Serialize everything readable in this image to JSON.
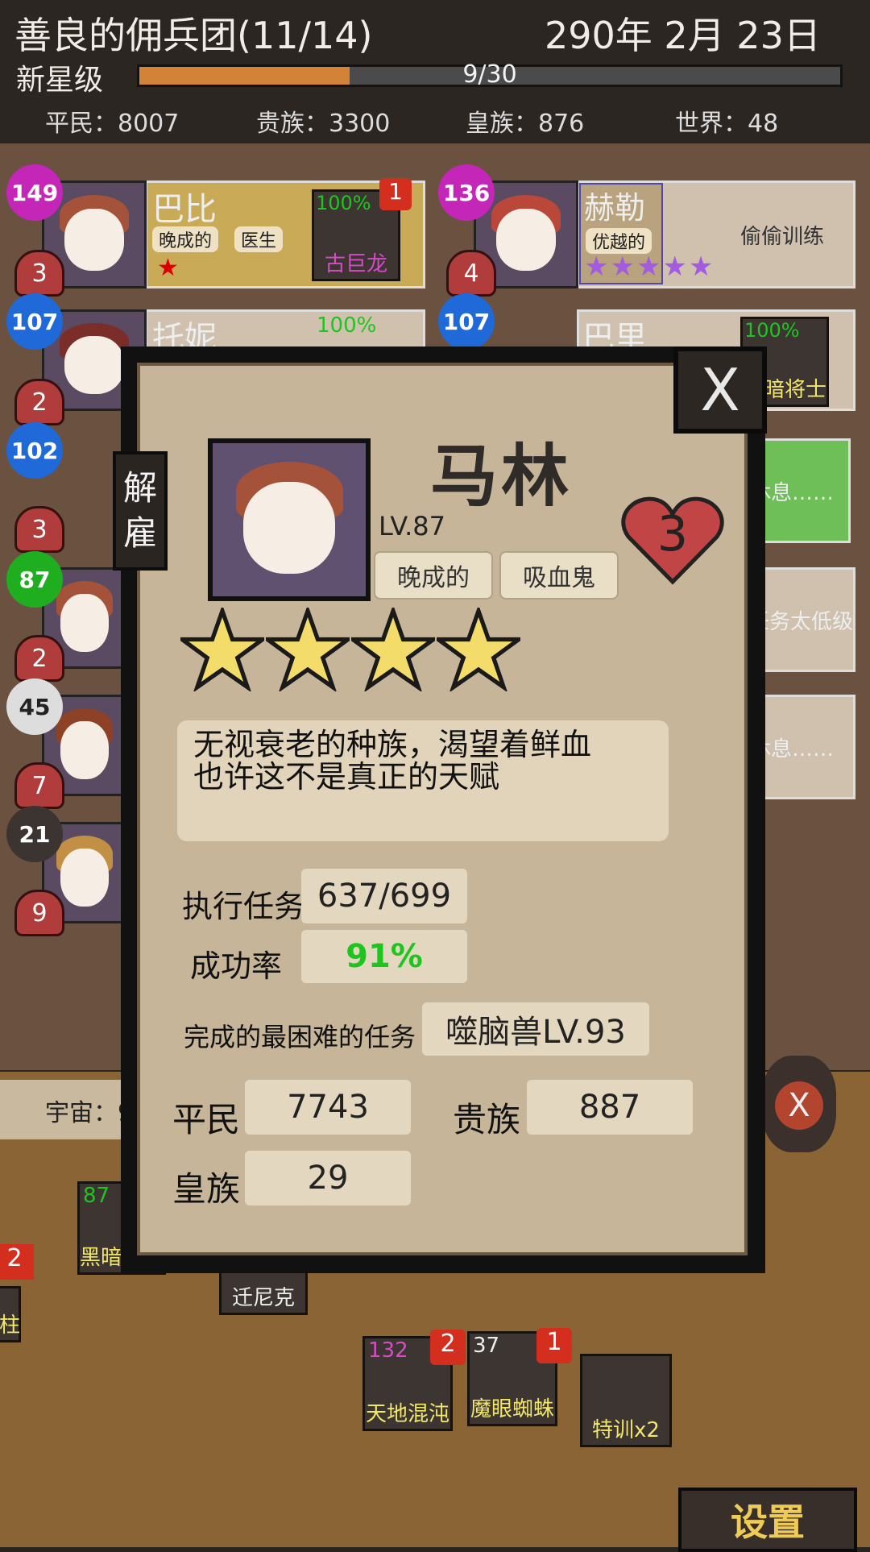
{
  "header": {
    "guild_name": "善良的佣兵团(11/14)",
    "date": "290年 2月 23日",
    "rank": "新星级",
    "xp_text": "9/30",
    "xp_fraction": 0.3,
    "populations": [
      "平民：8007",
      "贵族：3300",
      "皇族：876",
      "世界：48"
    ]
  },
  "roster": {
    "cards": [
      {
        "level": "149",
        "hearts": "3",
        "name": "巴比",
        "traits": [
          "晚成的",
          "医生"
        ],
        "progress": "100%",
        "item": "古巨龙",
        "item_badge": "1"
      },
      {
        "level": "136",
        "hearts": "4",
        "name": "赫勒",
        "traits": [
          "优越的"
        ],
        "status": "偷偷训练"
      },
      {
        "level": "107",
        "hearts": "2",
        "name": "托妮",
        "progress": "100%"
      },
      {
        "level": "107",
        "name": "巴里",
        "progress": "100%",
        "item": "黑暗将士"
      }
    ],
    "side_levels": [
      {
        "level": "102",
        "hearts": "3"
      },
      {
        "level": "87",
        "hearts": "2"
      },
      {
        "level": "45",
        "hearts": "7"
      },
      {
        "level": "21",
        "hearts": "9"
      }
    ],
    "right_status": [
      "休息……",
      "任务太低级",
      "休息……"
    ]
  },
  "modal": {
    "name": "马林",
    "level": "LV.87",
    "hearts": "3",
    "traits": [
      "晚成的",
      "吸血鬼"
    ],
    "stars": 4,
    "fire_label": "解雇",
    "close_label": "X",
    "description_lines": [
      "无视衰老的种族，渴望着鲜血",
      "也许这不是真正的天赋"
    ],
    "missions_label": "执行任务",
    "missions_value": "637/699",
    "success_label": "成功率",
    "success_value": "91%",
    "hardest_label": "完成的最困难的任务",
    "hardest_value": "噬脑兽LV.93",
    "commoner_label": "平民",
    "commoner_value": "7743",
    "noble_label": "贵族",
    "noble_value": "887",
    "royal_label": "皇族",
    "royal_value": "29"
  },
  "bottom": {
    "universe_label": "宇宙：9",
    "items": [
      {
        "label": "黑暗恶师",
        "count": "87"
      },
      {
        "label": "迁尼克"
      },
      {
        "label": "天地混沌",
        "count": "132",
        "badge": "2"
      },
      {
        "label": "魔眼蜘蛛",
        "count": "37",
        "badge": "1"
      },
      {
        "label": "特训x2"
      }
    ],
    "left_badge": "2",
    "left_label": "柱",
    "settings_label": "设置"
  },
  "colors": {
    "accent_orange": "#d28338",
    "success_green": "#1fc51f",
    "heart_red": "#b13c3c",
    "star_yellow": "#f4dc6a"
  }
}
